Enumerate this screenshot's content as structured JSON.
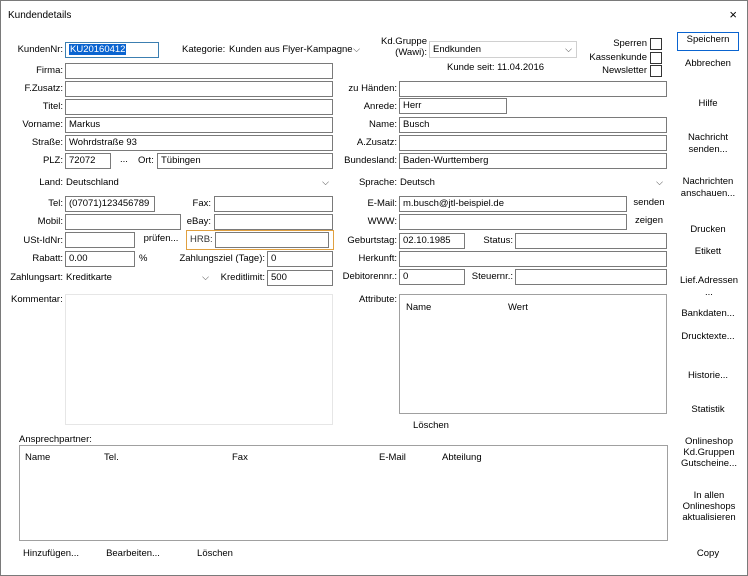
{
  "window": {
    "title": "Kundendetails",
    "close": "×"
  },
  "header": {
    "kundennr_label": "KundenNr:",
    "kundennr_value": "KU20160412",
    "kategorie_label": "Kategorie:",
    "kategorie_value": "Kunden aus Flyer-Kampagne",
    "kdgruppe_label_1": "Kd.Gruppe",
    "kdgruppe_label_2": "(Wawi):",
    "kdgruppe_value": "Endkunden",
    "kunde_seit": "Kunde seit: 11.04.2016",
    "sperren": "Sperren",
    "kassenkunde": "Kassenkunde",
    "newsletter": "Newsletter"
  },
  "left": {
    "firma_label": "Firma:",
    "firma_value": "",
    "zusatz_label": "F.Zusatz:",
    "zusatz_value": "",
    "titel_label": "Titel:",
    "titel_value": "",
    "vorname_label": "Vorname:",
    "vorname_value": "Markus",
    "strasse_label": "Straße:",
    "strasse_value": "Wohrdstraße 93",
    "plz_label": "PLZ:",
    "plz_value": "72072",
    "plz_lookup": "...",
    "ort_label": "Ort:",
    "ort_value": "Tübingen",
    "land_label": "Land:",
    "land_value": "Deutschland",
    "tel_label": "Tel:",
    "tel_value": "(07071)123456789",
    "fax_label": "Fax:",
    "fax_value": "",
    "mobil_label": "Mobil:",
    "mobil_value": "",
    "ebay_label": "eBay:",
    "ebay_value": "",
    "ustid_label": "USt-IdNr:",
    "ustid_value": "",
    "pruefen": "prüfen...",
    "hrb_label": "HRB:",
    "hrb_value": "",
    "rabatt_label": "Rabatt:",
    "rabatt_value": "0.00",
    "rabatt_unit": "%",
    "zahlungsziel_label": "Zahlungsziel (Tage):",
    "zahlungsziel_value": "0",
    "zahlungsart_label": "Zahlungsart:",
    "zahlungsart_value": "Kreditkarte",
    "kreditlimit_label": "Kreditlimit:",
    "kreditlimit_value": "500",
    "kommentar_label": "Kommentar:"
  },
  "right": {
    "zuhaenden_label": "zu Händen:",
    "zuhaenden_value": "",
    "anrede_label": "Anrede:",
    "anrede_value": "Herr",
    "name_label": "Name:",
    "name_value": "Busch",
    "azusatz_label": "A.Zusatz:",
    "azusatz_value": "",
    "bundesland_label": "Bundesland:",
    "bundesland_value": "Baden-Wurttemberg",
    "sprache_label": "Sprache:",
    "sprache_value": "Deutsch",
    "email_label": "E-Mail:",
    "email_value": "m.busch@jtl-beispiel.de",
    "senden": "senden",
    "www_label": "WWW:",
    "www_value": "",
    "zeigen": "zeigen",
    "geburtstag_label": "Geburtstag:",
    "geburtstag_value": "02.10.1985",
    "status_label": "Status:",
    "status_value": "",
    "herkunft_label": "Herkunft:",
    "herkunft_value": "",
    "debitorennr_label": "Debitorennr.:",
    "debitorennr_value": "0",
    "steuernr_label": "Steuernr.:",
    "steuernr_value": "",
    "attribute_label": "Attribute:",
    "attr_col_name": "Name",
    "attr_col_wert": "Wert",
    "loeschen": "Löschen"
  },
  "contacts": {
    "label": "Ansprechpartner:",
    "columns": [
      "Name",
      "Tel.",
      "Fax",
      "E-Mail",
      "Abteilung"
    ],
    "add": "Hinzufügen...",
    "edit": "Bearbeiten...",
    "delete": "Löschen"
  },
  "sidebar": {
    "speichern": "Speichern",
    "abbrechen": "Abbrechen",
    "hilfe": "Hilfe",
    "nachricht_senden": "Nachricht senden...",
    "nachrichten_anschauen": "Nachrichten anschauen...",
    "drucken": "Drucken",
    "etikett": "Etikett",
    "lief_adressen": "Lief.Adressen ...",
    "bankdaten": "Bankdaten...",
    "drucktexte": "Drucktexte...",
    "historie": "Historie...",
    "statistik": "Statistik",
    "onlineshop_gruppen": "Onlineshop Kd.Gruppen Gutscheine...",
    "in_allen_onlineshops": "In allen Onlineshops aktualisieren",
    "copy": "Copy"
  }
}
